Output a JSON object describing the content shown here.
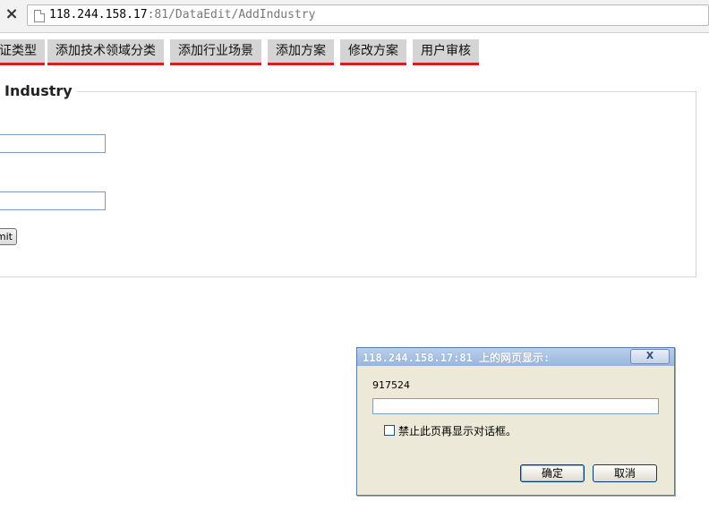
{
  "browser": {
    "close_icon": "×",
    "url_host": "118.244.158.17",
    "url_rest": ":81/DataEdit/AddIndustry"
  },
  "tabs": [
    {
      "label": "证类型"
    },
    {
      "label": "添加技术领域分类"
    },
    {
      "label": "添加行业场景"
    },
    {
      "label": "添加方案"
    },
    {
      "label": "修改方案"
    },
    {
      "label": "用户审核"
    }
  ],
  "form": {
    "legend": "Industry",
    "submit_label": "mit"
  },
  "dialog": {
    "title": "118.244.158.17:81 上的网页显示:",
    "close_label": "X",
    "message": "917524",
    "input_value": "",
    "checkbox_label": "禁止此页再显示对话框。",
    "ok_label": "确定",
    "cancel_label": "取消"
  },
  "colors": {
    "tab_underline": "#d42020",
    "tab_background": "#d4d4d4",
    "dialog_background": "#ece9d8",
    "dialog_titlebar": "#98b6de"
  }
}
